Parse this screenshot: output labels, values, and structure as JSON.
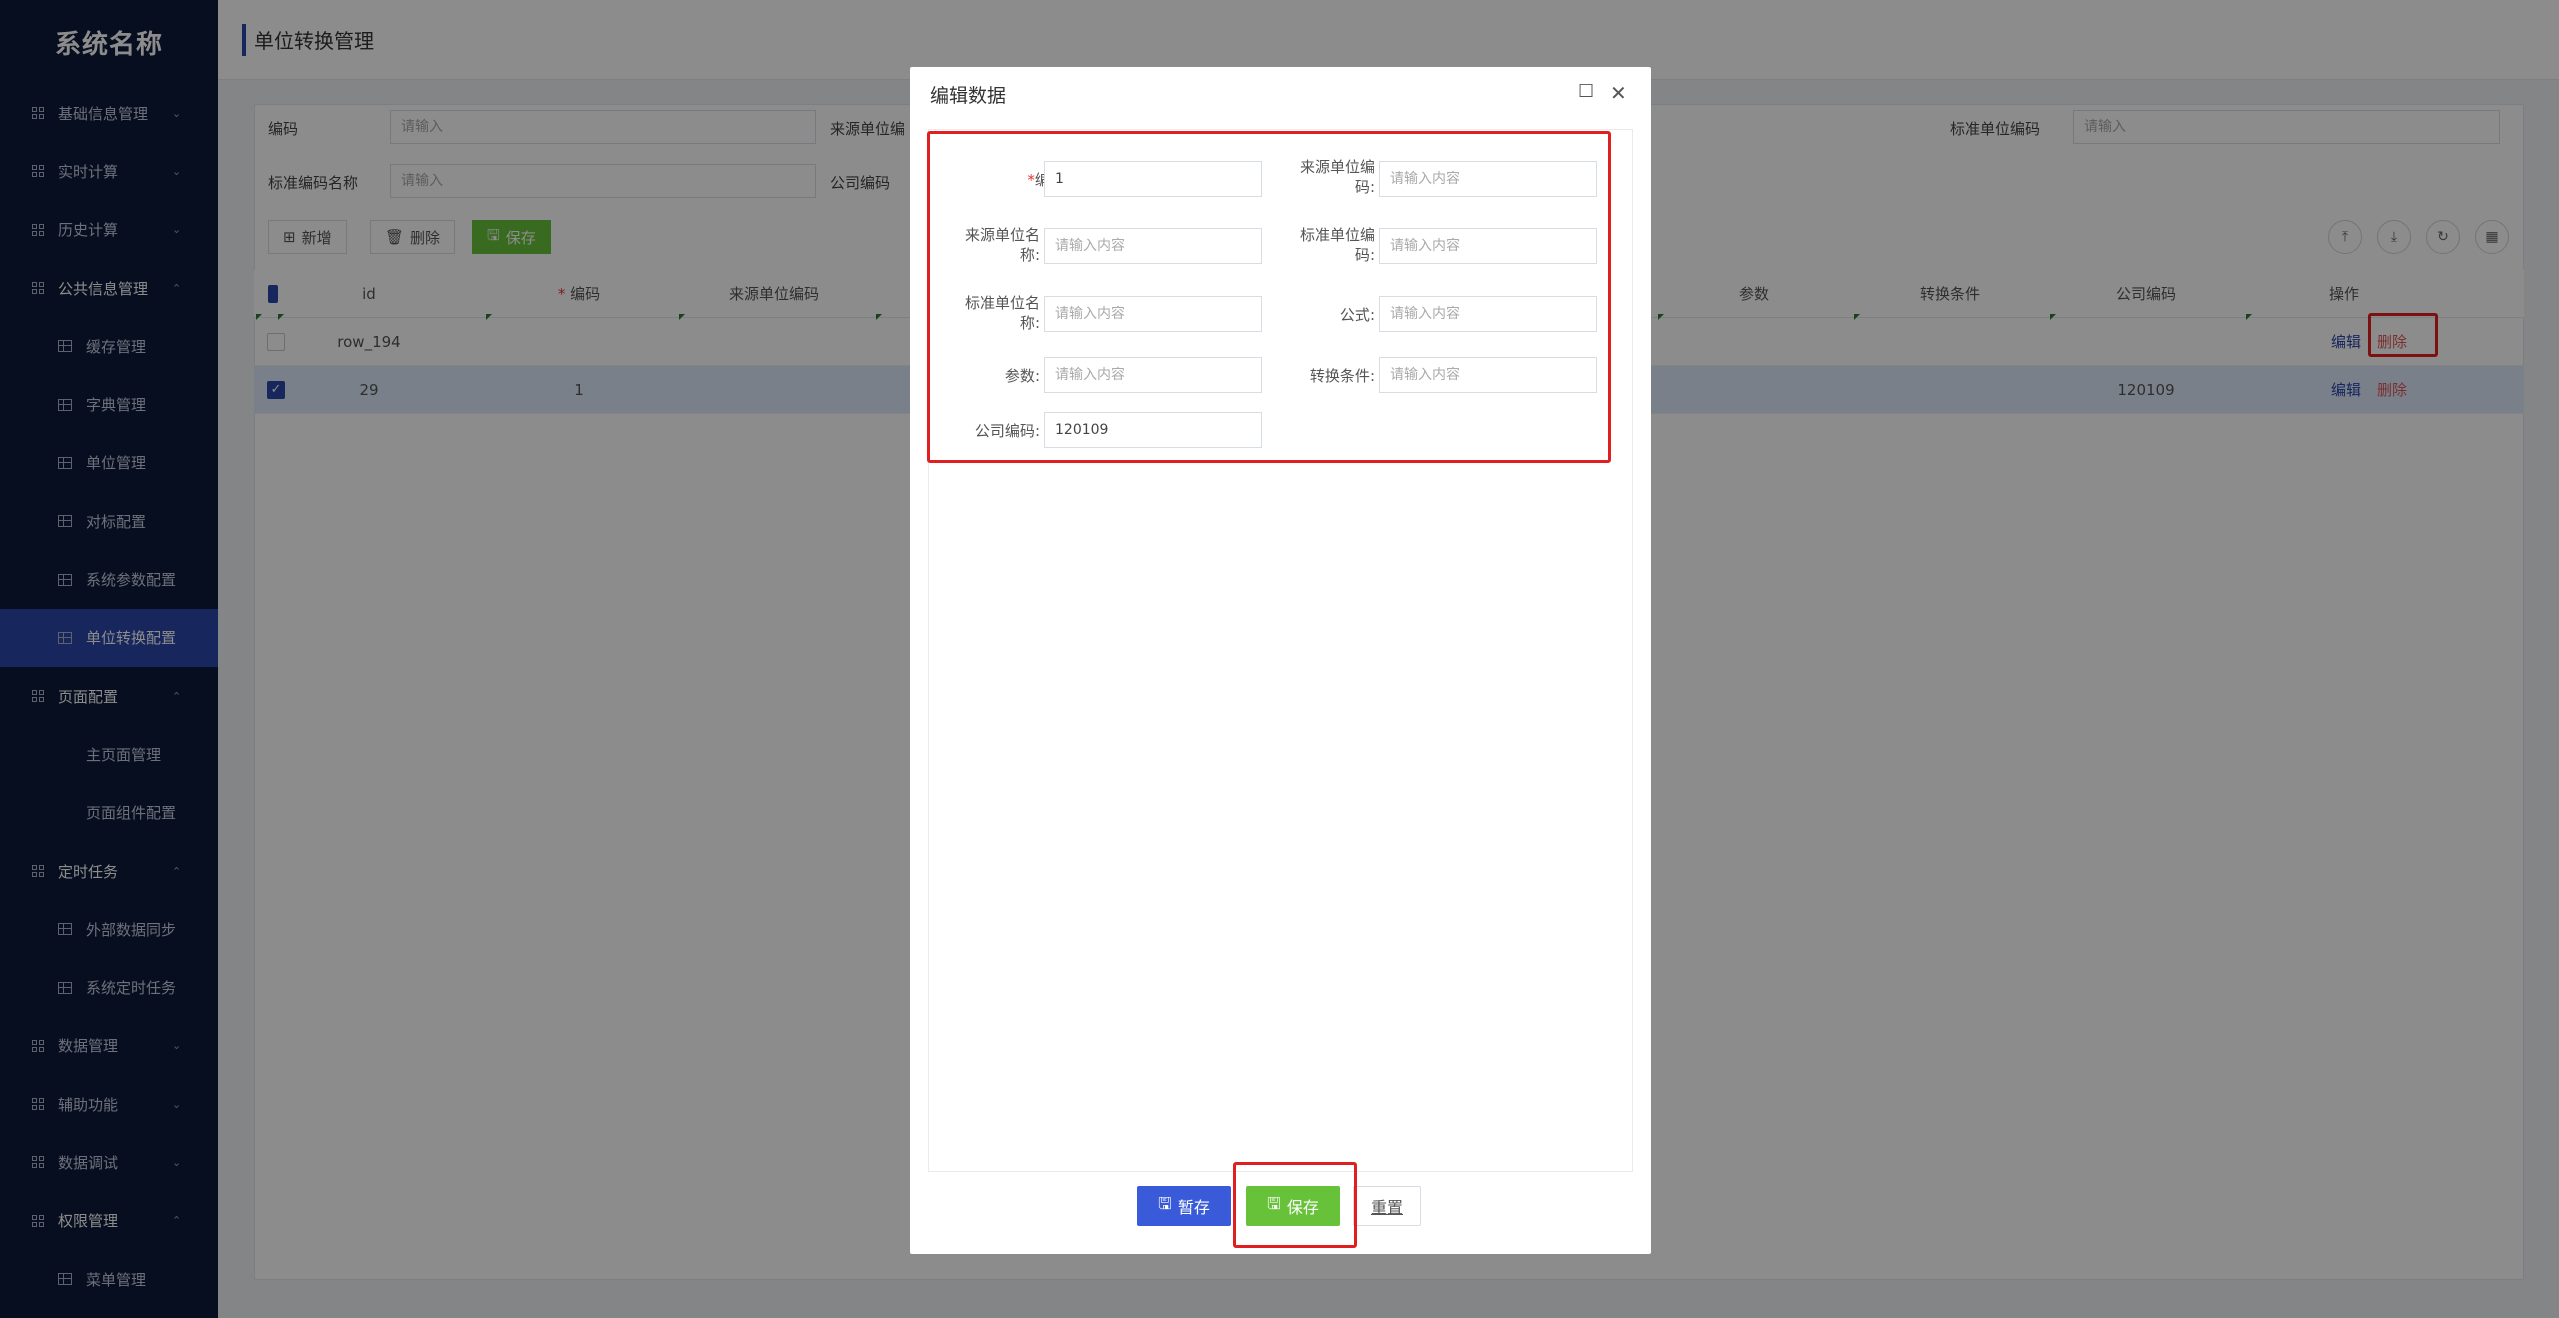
{
  "sidebar": {
    "title": "系统名称",
    "items": [
      {
        "label": "基础信息管理",
        "level": 1,
        "icon": "grid-icon",
        "chevron": "⌄",
        "key": "basic-info"
      },
      {
        "label": "实时计算",
        "level": 1,
        "icon": "grid-icon",
        "chevron": "⌄",
        "key": "realtime-calc"
      },
      {
        "label": "历史计算",
        "level": 1,
        "icon": "grid-icon",
        "chevron": "⌄",
        "key": "history-calc"
      },
      {
        "label": "公共信息管理",
        "level": 1,
        "icon": "grid-icon",
        "chevron": "⌃",
        "key": "public-info",
        "open": true
      },
      {
        "label": "缓存管理",
        "level": 2,
        "icon": "table-icon",
        "key": "cache-mgmt"
      },
      {
        "label": "字典管理",
        "level": 2,
        "icon": "table-icon",
        "key": "dict-mgmt"
      },
      {
        "label": "单位管理",
        "level": 2,
        "icon": "table-icon",
        "key": "unit-mgmt"
      },
      {
        "label": "对标配置",
        "level": 2,
        "icon": "table-icon",
        "key": "benchmark-config"
      },
      {
        "label": "系统参数配置",
        "level": 2,
        "icon": "table-icon",
        "key": "sys-param-config"
      },
      {
        "label": "单位转换配置",
        "level": 2,
        "icon": "table-icon",
        "key": "unit-convert-config",
        "active": true
      },
      {
        "label": "页面配置",
        "level": 1,
        "icon": "grid-icon",
        "chevron": "⌃",
        "key": "page-config",
        "open": true
      },
      {
        "label": "主页面管理",
        "level": 3,
        "key": "main-page-mgmt"
      },
      {
        "label": "页面组件配置",
        "level": 3,
        "key": "page-component-config"
      },
      {
        "label": "定时任务",
        "level": 1,
        "icon": "grid-icon",
        "chevron": "⌃",
        "key": "scheduled-tasks",
        "open": true
      },
      {
        "label": "外部数据同步",
        "level": 2,
        "icon": "table-icon",
        "key": "external-sync"
      },
      {
        "label": "系统定时任务",
        "level": 2,
        "icon": "table-icon",
        "key": "sys-scheduled"
      },
      {
        "label": "数据管理",
        "level": 1,
        "icon": "grid-icon",
        "chevron": "⌄",
        "key": "data-mgmt"
      },
      {
        "label": "辅助功能",
        "level": 1,
        "icon": "grid-icon",
        "chevron": "⌄",
        "key": "aux-func"
      },
      {
        "label": "数据调试",
        "level": 1,
        "icon": "grid-icon",
        "chevron": "⌄",
        "key": "data-debug"
      },
      {
        "label": "权限管理",
        "level": 1,
        "icon": "grid-icon",
        "chevron": "⌃",
        "key": "perm-mgmt",
        "open": true
      },
      {
        "label": "菜单管理",
        "level": 2,
        "icon": "table-icon",
        "key": "menu-mgmt"
      }
    ]
  },
  "page": {
    "title": "单位转换管理"
  },
  "search": {
    "fields": [
      {
        "label": "编码",
        "placeholder": "请输入"
      },
      {
        "label": "来源单位编",
        "placeholder": "请输入"
      },
      {
        "label": "标准单位编码",
        "placeholder": "请输入"
      },
      {
        "label": "标准编码名称",
        "placeholder": "请输入"
      },
      {
        "label": "公司编码",
        "placeholder": ""
      }
    ]
  },
  "toolbar": {
    "add_label": "新增",
    "delete_label": "删除",
    "save_label": "保存"
  },
  "table": {
    "headers": [
      "id",
      "编码",
      "来源单位编码",
      "参数",
      "转换条件",
      "公司编码",
      "操作"
    ],
    "required_mark": "*",
    "rows": [
      {
        "id": "row_194",
        "code": "",
        "company": "",
        "edit": "编辑",
        "delete": "删除",
        "checked": false
      },
      {
        "id": "29",
        "code": "1",
        "company": "120109",
        "edit": "编辑",
        "delete": "删除",
        "checked": true
      }
    ]
  },
  "modal": {
    "title": "编辑数据",
    "fields": {
      "code": {
        "label": "编码",
        "value": "1"
      },
      "src_unit_code": {
        "label_1": "来源单位编",
        "label_2": "码",
        "placeholder": "请输入内容"
      },
      "src_unit_name": {
        "label_1": "来源单位名",
        "label_2": "称",
        "placeholder": "请输入内容"
      },
      "std_unit_code": {
        "label_1": "标准单位编",
        "label_2": "码",
        "placeholder": "请输入内容"
      },
      "std_unit_name": {
        "label_1": "标准单位名",
        "label_2": "称",
        "placeholder": "请输入内容"
      },
      "formula": {
        "label": "公式",
        "placeholder": "请输入内容"
      },
      "param": {
        "label": "参数",
        "placeholder": "请输入内容"
      },
      "condition": {
        "label": "转换条件",
        "placeholder": "请输入内容"
      },
      "company": {
        "label": "公司编码",
        "value": "120109"
      }
    },
    "colon": ":",
    "required_mark": "*",
    "buttons": {
      "draft": "暂存",
      "save": "保存",
      "reset": "重置"
    }
  },
  "colors": {
    "sidebar_bg": "#0d1a3a",
    "accent": "#2a45a8",
    "green": "#67c23a",
    "highlight": "#e02020"
  }
}
